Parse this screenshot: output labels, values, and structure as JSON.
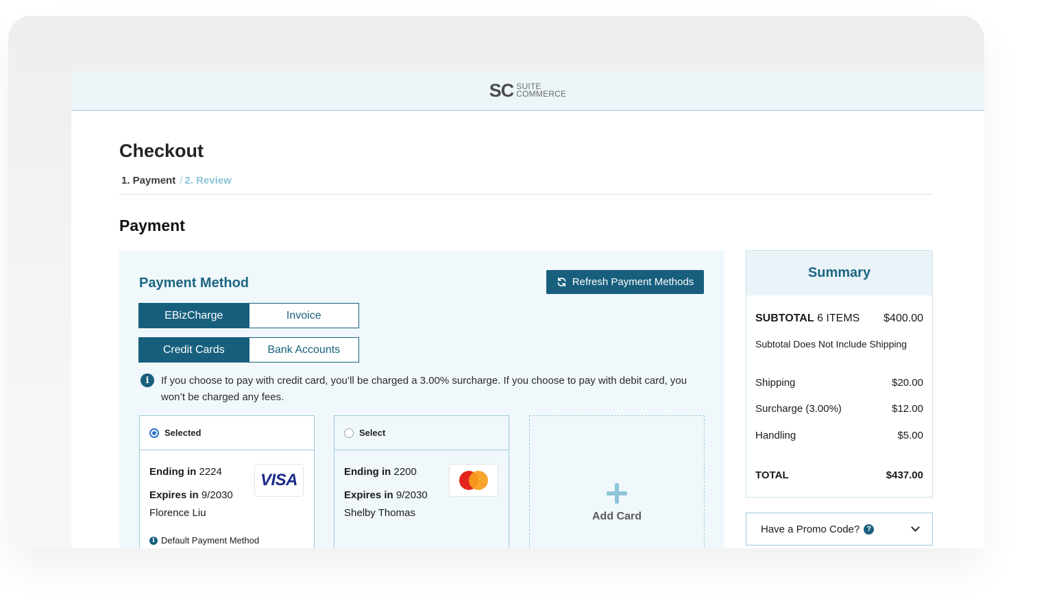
{
  "header": {
    "logo_mark": "SC",
    "logo_line1": "SUITE",
    "logo_line2": "COMMERCE"
  },
  "page": {
    "title": "Checkout",
    "breadcrumb": {
      "current": "1. Payment",
      "separator": "/",
      "next": "2. Review"
    },
    "section_title": "Payment"
  },
  "payment_method": {
    "title": "Payment Method",
    "refresh_label": "Refresh Payment Methods",
    "provider_tabs": [
      "EBizCharge",
      "Invoice"
    ],
    "type_tabs": [
      "Credit Cards",
      "Bank Accounts"
    ],
    "notice": "If you choose to pay with credit card, you’ll be charged a 3.00% surcharge. If you choose to pay with debit card, you won’t be charged any fees.",
    "cards": [
      {
        "status": "Selected",
        "ending_label": "Ending in",
        "ending": "2224",
        "expires_label": "Expires in",
        "expires": "9/2030",
        "holder": "Florence Liu",
        "brand": "VISA",
        "default_label": "Default Payment Method"
      },
      {
        "status": "Select",
        "ending_label": "Ending in",
        "ending": "2200",
        "expires_label": "Expires in",
        "expires": "9/2030",
        "holder": "Shelby Thomas",
        "brand": "mastercard-icon"
      }
    ],
    "add_card_label": "Add Card"
  },
  "summary": {
    "title": "Summary",
    "subtotal_label": "SUBTOTAL",
    "subtotal_items": "6 ITEMS",
    "subtotal_value": "$400.00",
    "subtotal_note": "Subtotal Does Not Include Shipping",
    "shipping_label": "Shipping",
    "shipping_value": "$20.00",
    "surcharge_label": "Surcharge (3.00%)",
    "surcharge_value": "$12.00",
    "handling_label": "Handling",
    "handling_value": "$5.00",
    "total_label": "TOTAL",
    "total_value": "$437.00"
  },
  "promo": {
    "label": "Have a Promo Code?",
    "help_glyph": "?"
  },
  "colors": {
    "brand_primary": "#175f7d",
    "brand_light": "#f0f8fb",
    "accent_light": "#8cc4d8"
  }
}
